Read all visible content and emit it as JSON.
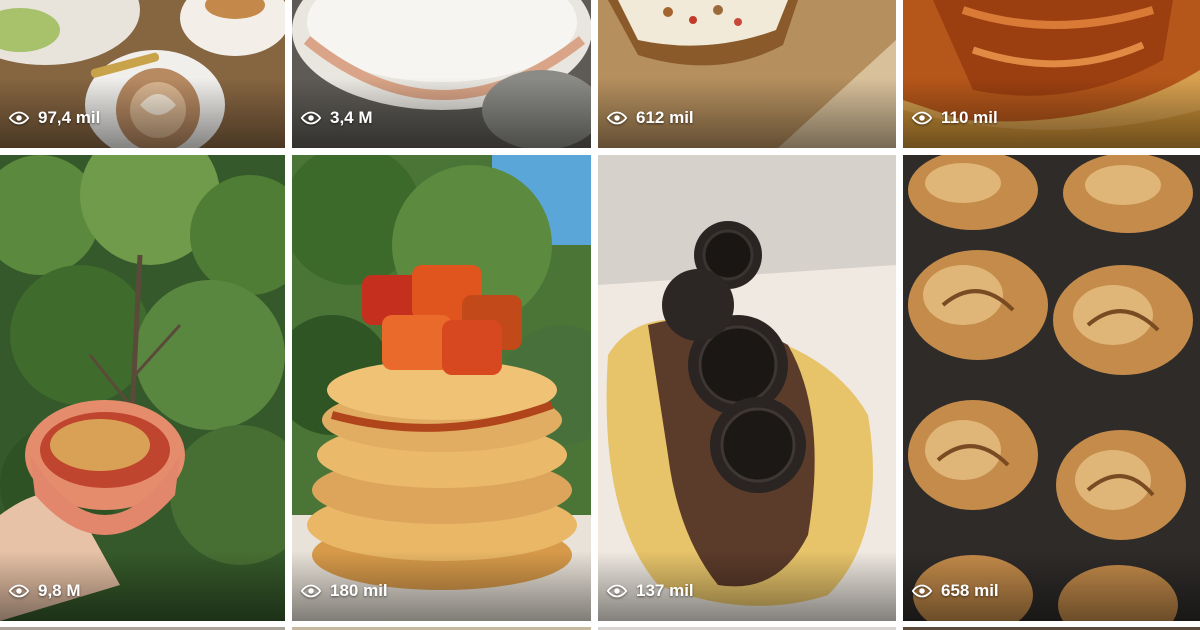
{
  "tiles": [
    {
      "views": "97,4 mil",
      "subject": "coffee and brunch plate on wooden table"
    },
    {
      "views": "3,4 M",
      "subject": "flour dusted dough in a bowl"
    },
    {
      "views": "612 mil",
      "subject": "toast with cream and nuts in a box"
    },
    {
      "views": "110 mil",
      "subject": "glazed croissant"
    },
    {
      "views": "9,8 M",
      "subject": "hand holding a bowl of baked dish in front of trees"
    },
    {
      "views": "180 mil",
      "subject": "stack of pancakes with caramelized apples"
    },
    {
      "views": "137 mil",
      "subject": "croissant with chocolate spread and oreo cookies"
    },
    {
      "views": "658 mil",
      "subject": "cinnamon buns in a muffin tray"
    }
  ],
  "icons": {
    "views": "eye-icon"
  }
}
